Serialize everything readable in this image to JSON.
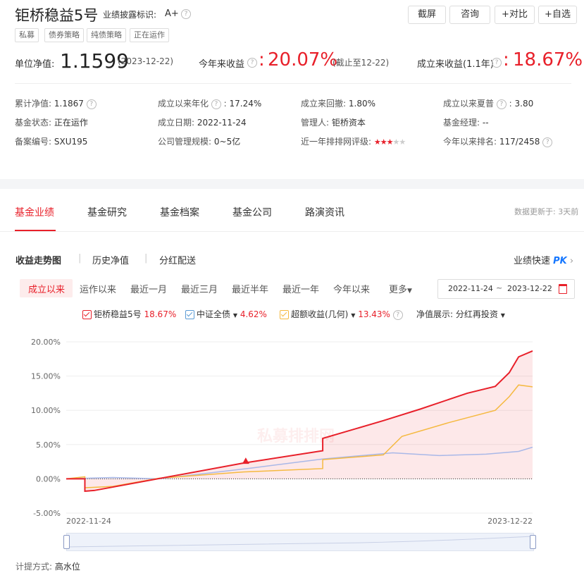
{
  "fund": {
    "name": "钜桥稳益5号",
    "disclosure_label": "业绩披露标识:",
    "disclosure_value": "A+",
    "tags": [
      "私募",
      "债券策略",
      "纯债策略",
      "正在运作"
    ]
  },
  "toolbar": {
    "screenshot": "截屏",
    "consult": "咨询",
    "compare": "+对比",
    "favorite": "+自选"
  },
  "headline": {
    "nav_label": "单位净值:",
    "nav_value": "1.1599",
    "nav_date": "(2023-12-22)",
    "ytd_label": "今年来收益",
    "ytd_value": "20.07%",
    "ytd_note": "(截止至12-22)",
    "since_label": "成立来收益(1.1年)",
    "since_value": "18.67%"
  },
  "info": {
    "cum_nav_label": "累计净值:",
    "cum_nav_value": "1.1867",
    "annual_label": "成立以来年化",
    "annual_value": "17.24%",
    "drawdown_label": "成立来回撤:",
    "drawdown_value": "1.80%",
    "sharpe_label": "成立以来夏普",
    "sharpe_value": "3.80",
    "status_label": "基金状态:",
    "status_value": "正在运作",
    "date_label": "成立日期:",
    "date_value": "2022-11-24",
    "manager_label": "管理人:",
    "manager_value": "钜桥资本",
    "fm_label": "基金经理:",
    "fm_value": "--",
    "reg_label": "备案编号:",
    "reg_value": "SXU195",
    "scale_label": "公司管理规模:",
    "scale_value": "0~5亿",
    "rating_label": "近一年排排网评级:",
    "rating_stars": 3,
    "rank_label": "今年以来排名:",
    "rank_value": "117/2458"
  },
  "tabs": {
    "items": [
      "基金业绩",
      "基金研究",
      "基金档案",
      "基金公司",
      "路演资讯"
    ],
    "update_note": "数据更新于: 3天前"
  },
  "subtabs": {
    "items": [
      "收益走势图",
      "历史净值",
      "分红配送"
    ],
    "quick": "业绩快速",
    "pk": "PK"
  },
  "ranges": {
    "items": [
      "成立以来",
      "运作以来",
      "最近一月",
      "最近三月",
      "最近半年",
      "最近一年",
      "今年以来"
    ],
    "more": "更多",
    "start": "2022-11-24",
    "tilde": "~",
    "end": "2023-12-22"
  },
  "legend": {
    "s1_name": "钜桥稳益5号",
    "s1_val": "18.67%",
    "s2_name": "中证全债",
    "s2_val": "4.62%",
    "s3_name": "超额收益(几何)",
    "s3_val": "13.43%",
    "nav_mode_label": "净值展示:",
    "nav_mode_value": "分红再投资"
  },
  "footer": {
    "fee_label": "计提方式:",
    "fee_value": "高水位"
  },
  "watermark": "私募排排网",
  "colors": {
    "fund": "#e8202a",
    "index": "#a9b8e8",
    "excess": "#f5b940"
  },
  "chart_data": {
    "type": "line",
    "x_start": "2022-11-24",
    "x_end": "2023-12-22",
    "y_unit": "%",
    "ylim": [
      -5,
      20
    ],
    "yticks": [
      "20.00%",
      "15.00%",
      "10.00%",
      "5.00%",
      "0.00%",
      "-5.00%"
    ],
    "xtick_labels": [
      "2022-11-24",
      "2023-12-22"
    ],
    "grid": true,
    "series": [
      {
        "name": "钜桥稳益5号",
        "x": [
          0,
          0.04,
          0.04,
          0.06,
          0.38,
          0.38,
          0.55,
          0.55,
          0.68,
          0.76,
          0.86,
          0.92,
          0.95,
          0.97,
          1.0
        ],
        "y": [
          0,
          0,
          -1.8,
          -1.7,
          2.3,
          2.3,
          4.1,
          5.9,
          8.5,
          10.2,
          12.5,
          13.5,
          15.5,
          17.8,
          18.67
        ]
      },
      {
        "name": "中证全债",
        "x": [
          0,
          0.1,
          0.2,
          0.4,
          0.55,
          0.7,
          0.8,
          0.9,
          0.97,
          1.0
        ],
        "y": [
          0,
          0.2,
          0,
          1.6,
          2.9,
          3.8,
          3.4,
          3.6,
          4.0,
          4.62
        ]
      },
      {
        "name": "超额收益(几何)",
        "x": [
          0,
          0.04,
          0.04,
          0.1,
          0.2,
          0.38,
          0.55,
          0.55,
          0.68,
          0.72,
          0.82,
          0.92,
          0.95,
          0.97,
          1.0
        ],
        "y": [
          0,
          0.3,
          -1.3,
          -1.1,
          0.1,
          1.0,
          1.5,
          2.8,
          3.5,
          6.2,
          8.2,
          10.0,
          12.0,
          13.7,
          13.43
        ]
      }
    ]
  }
}
